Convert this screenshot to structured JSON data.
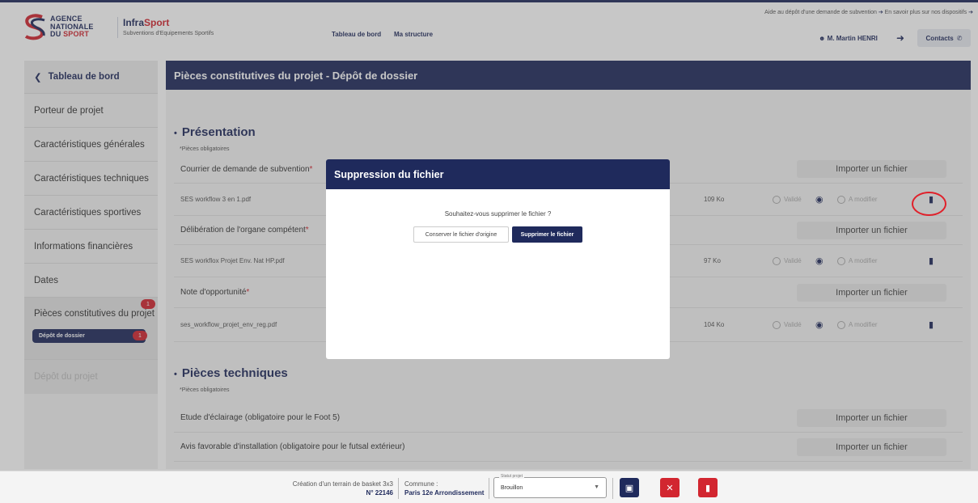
{
  "header": {
    "logo": {
      "line1": "AGENCE",
      "line2": "NATIONALE",
      "line3_a": "DU ",
      "line3_b": "SPORT"
    },
    "app_title_a": "Infra",
    "app_title_b": "Sport",
    "app_subtitle": "Subventions d'Equipements Sportifs",
    "nav": [
      "Tableau de bord",
      "Ma structure"
    ],
    "help_link": "Aide au dépôt d'une demande de subvention",
    "more_link": "En savoir plus sur nos dispositifs",
    "user": "M. Martin HENRI",
    "contacts": "Contacts"
  },
  "sidebar": {
    "back": "Tableau de bord",
    "items": [
      "Porteur de projet",
      "Caractéristiques générales",
      "Caractéristiques techniques",
      "Caractéristiques sportives",
      "Informations financières",
      "Dates",
      "Pièces constitutives du projet"
    ],
    "pieces_badge": "1",
    "sub_item": "Dépôt de dossier",
    "sub_badge": "1",
    "disabled_item": "Dépôt du projet"
  },
  "main": {
    "title": "Pièces constitutives du projet - Dépôt de dossier",
    "sections": [
      {
        "title": "Présentation",
        "required_note": "*Pièces obligatoires",
        "docs": [
          {
            "label": "Courrier de demande de subvention ",
            "file": "SES workflow 3 en 1.pdf",
            "size": "109 Ko"
          },
          {
            "label": "Délibération de l'organe compétent ",
            "file": "SES workflox Projet Env. Nat HP.pdf",
            "size": "97 Ko"
          },
          {
            "label": "Note d'opportunité ",
            "file": "ses_workflow_projet_env_reg.pdf",
            "size": "104 Ko"
          }
        ]
      },
      {
        "title": "Pièces techniques",
        "required_note": "*Pièces obligatoires",
        "docs": [
          {
            "label": "Etude d'éclairage (obligatoire pour le Foot 5)"
          },
          {
            "label": "Avis favorable d'installation (obligatoire pour le futsal extérieur)"
          }
        ]
      }
    ],
    "import_label": "Importer un fichier",
    "valid_label": "Validé",
    "modify_label": "A modifier",
    "required_star": "*"
  },
  "modal": {
    "title": "Suppression du fichier",
    "question": "Souhaitez-vous supprimer le fichier ?",
    "keep_button": "Conserver le fichier d'origine",
    "delete_button": "Supprimer le fichier"
  },
  "footer": {
    "project_name": "Création d'un terrain de basket 3x3",
    "project_number": "N° 22146",
    "commune_label": "Commune :",
    "commune_value": "Paris 12e Arrondissement",
    "status_label": "Statut projet",
    "status_value": "Brouillon"
  },
  "colors": {
    "primary": "#1f2a5c",
    "danger": "#d22630",
    "highlight": "#e0202a"
  }
}
